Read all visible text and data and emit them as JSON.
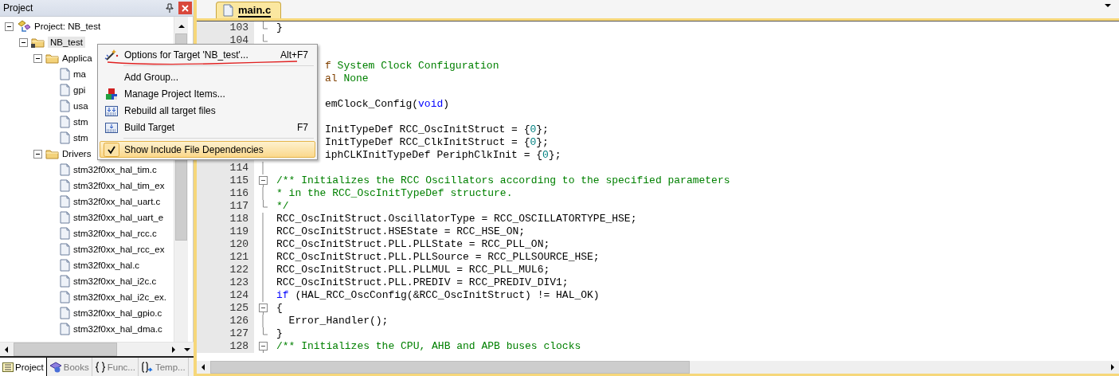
{
  "project_panel": {
    "title": "Project",
    "tree": [
      {
        "label": "Project: NB_test",
        "kind": "project",
        "expanded": true,
        "selected": false,
        "children": [
          {
            "label": "NB_test",
            "kind": "target",
            "expanded": true,
            "selected": true,
            "children": [
              {
                "label": "Applica",
                "kind": "group",
                "expanded": true,
                "selected": false,
                "children": [
                  {
                    "label": "ma",
                    "kind": "file",
                    "selected": false
                  },
                  {
                    "label": "gpi",
                    "kind": "file",
                    "selected": false
                  },
                  {
                    "label": "usa",
                    "kind": "file",
                    "selected": false
                  },
                  {
                    "label": "stm",
                    "kind": "file",
                    "selected": false
                  },
                  {
                    "label": "stm",
                    "kind": "file",
                    "selected": false
                  }
                ]
              },
              {
                "label": "Drivers",
                "kind": "group",
                "expanded": true,
                "selected": false,
                "children": [
                  {
                    "label": "stm32f0xx_hal_tim.c",
                    "kind": "file",
                    "selected": false
                  },
                  {
                    "label": "stm32f0xx_hal_tim_ex",
                    "kind": "file",
                    "selected": false
                  },
                  {
                    "label": "stm32f0xx_hal_uart.c",
                    "kind": "file",
                    "selected": false
                  },
                  {
                    "label": "stm32f0xx_hal_uart_e",
                    "kind": "file",
                    "selected": false
                  },
                  {
                    "label": "stm32f0xx_hal_rcc.c",
                    "kind": "file",
                    "selected": false
                  },
                  {
                    "label": "stm32f0xx_hal_rcc_ex",
                    "kind": "file",
                    "selected": false
                  },
                  {
                    "label": "stm32f0xx_hal.c",
                    "kind": "file",
                    "selected": false
                  },
                  {
                    "label": "stm32f0xx_hal_i2c.c",
                    "kind": "file",
                    "selected": false
                  },
                  {
                    "label": "stm32f0xx_hal_i2c_ex.",
                    "kind": "file",
                    "selected": false
                  },
                  {
                    "label": "stm32f0xx_hal_gpio.c",
                    "kind": "file",
                    "selected": false
                  },
                  {
                    "label": "stm32f0xx_hal_dma.c",
                    "kind": "file",
                    "selected": false
                  }
                ]
              }
            ]
          }
        ]
      }
    ],
    "bottom_tabs": [
      {
        "label": "Project",
        "kind": "project",
        "selected": true
      },
      {
        "label": "Books",
        "kind": "books",
        "selected": false
      },
      {
        "label": "Func...",
        "kind": "functions",
        "selected": false
      },
      {
        "label": "Temp...",
        "kind": "templates",
        "selected": false
      }
    ]
  },
  "editor": {
    "tabs": [
      {
        "label": "main.c",
        "selected": true
      }
    ],
    "lines": [
      {
        "kind": "code",
        "number": "103",
        "segments": [
          {
            "text": "}",
            "kind": "plain"
          }
        ]
      },
      {
        "kind": "code",
        "number": "104"
      },
      {
        "kind": "occluded"
      },
      {
        "kind": "occluded",
        "segments": [
          {
            "text": "f",
            "kind": "tag"
          },
          {
            "text": " System Clock Configuration",
            "kind": "comment"
          }
        ]
      },
      {
        "kind": "occluded",
        "segments": [
          {
            "text": "al",
            "kind": "tag"
          },
          {
            "text": " None",
            "kind": "comment"
          }
        ]
      },
      {
        "kind": "occluded"
      },
      {
        "kind": "occluded",
        "segments": [
          {
            "text": "emClock_Config(",
            "kind": "plain"
          },
          {
            "text": "void",
            "kind": "keyword"
          },
          {
            "text": ")",
            "kind": "plain"
          }
        ]
      },
      {
        "kind": "occluded"
      },
      {
        "kind": "occluded",
        "segments": [
          {
            "text": "InitTypeDef RCC_OscInitStruct = {",
            "kind": "plain"
          },
          {
            "text": "0",
            "kind": "number"
          },
          {
            "text": "};",
            "kind": "plain"
          }
        ]
      },
      {
        "kind": "occluded",
        "segments": [
          {
            "text": "InitTypeDef RCC_ClkInitStruct = {",
            "kind": "plain"
          },
          {
            "text": "0",
            "kind": "number"
          },
          {
            "text": "};",
            "kind": "plain"
          }
        ]
      },
      {
        "kind": "occluded",
        "segments": [
          {
            "text": "iphCLKInitTypeDef PeriphClkInit = {",
            "kind": "plain"
          },
          {
            "text": "0",
            "kind": "number"
          },
          {
            "text": "};",
            "kind": "plain"
          }
        ]
      },
      {
        "kind": "code",
        "number": "114"
      },
      {
        "kind": "code",
        "number": "115",
        "segments": [
          {
            "text": "/** Initializes the RCC Oscillators according to the specified parameters",
            "kind": "comment"
          }
        ]
      },
      {
        "kind": "code",
        "number": "116",
        "segments": [
          {
            "text": "* in the RCC_OscInitTypeDef structure.",
            "kind": "comment"
          }
        ]
      },
      {
        "kind": "code",
        "number": "117",
        "segments": [
          {
            "text": "*/",
            "kind": "comment"
          }
        ]
      },
      {
        "kind": "code",
        "number": "118",
        "segments": [
          {
            "text": "RCC_OscInitStruct.OscillatorType = RCC_OSCILLATORTYPE_HSE;",
            "kind": "plain"
          }
        ]
      },
      {
        "kind": "code",
        "number": "119",
        "segments": [
          {
            "text": "RCC_OscInitStruct.HSEState = RCC_HSE_ON;",
            "kind": "plain"
          }
        ]
      },
      {
        "kind": "code",
        "number": "120",
        "segments": [
          {
            "text": "RCC_OscInitStruct.PLL.PLLState = RCC_PLL_ON;",
            "kind": "plain"
          }
        ]
      },
      {
        "kind": "code",
        "number": "121",
        "segments": [
          {
            "text": "RCC_OscInitStruct.PLL.PLLSource = RCC_PLLSOURCE_HSE;",
            "kind": "plain"
          }
        ]
      },
      {
        "kind": "code",
        "number": "122",
        "segments": [
          {
            "text": "RCC_OscInitStruct.PLL.PLLMUL = RCC_PLL_MUL6;",
            "kind": "plain"
          }
        ]
      },
      {
        "kind": "code",
        "number": "123",
        "segments": [
          {
            "text": "RCC_OscInitStruct.PLL.PREDIV = RCC_PREDIV_DIV1;",
            "kind": "plain"
          }
        ]
      },
      {
        "kind": "code",
        "number": "124",
        "segments": [
          {
            "text": "if",
            "kind": "keyword"
          },
          {
            "text": " (HAL_RCC_OscConfig(&RCC_OscInitStruct) != HAL_OK)",
            "kind": "plain"
          }
        ]
      },
      {
        "kind": "code",
        "number": "125",
        "segments": [
          {
            "text": "{",
            "kind": "plain"
          }
        ]
      },
      {
        "kind": "code",
        "number": "126",
        "segments": [
          {
            "text": "  Error_Handler();",
            "kind": "plain"
          }
        ]
      },
      {
        "kind": "code",
        "number": "127",
        "segments": [
          {
            "text": "}",
            "kind": "plain"
          }
        ]
      },
      {
        "kind": "code",
        "number": "128",
        "segments": [
          {
            "text": "/** Initializes the CPU, AHB and APB buses clocks",
            "kind": "comment"
          }
        ]
      }
    ]
  },
  "context_menu": {
    "items": [
      {
        "kind": "item",
        "label": "Options for Target 'NB_test'...",
        "shortcut": "Alt+F7",
        "annotated": true,
        "checked": false,
        "highlighted": false
      },
      {
        "kind": "separator"
      },
      {
        "kind": "item",
        "label": "Add Group...",
        "checked": false,
        "highlighted": false
      },
      {
        "kind": "item",
        "label": "Manage Project Items...",
        "checked": false,
        "highlighted": false
      },
      {
        "kind": "item",
        "label": "Rebuild all target files",
        "checked": false,
        "highlighted": false
      },
      {
        "kind": "item",
        "label": "Build Target",
        "shortcut": "F7",
        "checked": false,
        "highlighted": false
      },
      {
        "kind": "separator"
      },
      {
        "kind": "item",
        "label": "Show Include File Dependencies",
        "checked": true,
        "highlighted": true
      }
    ]
  }
}
